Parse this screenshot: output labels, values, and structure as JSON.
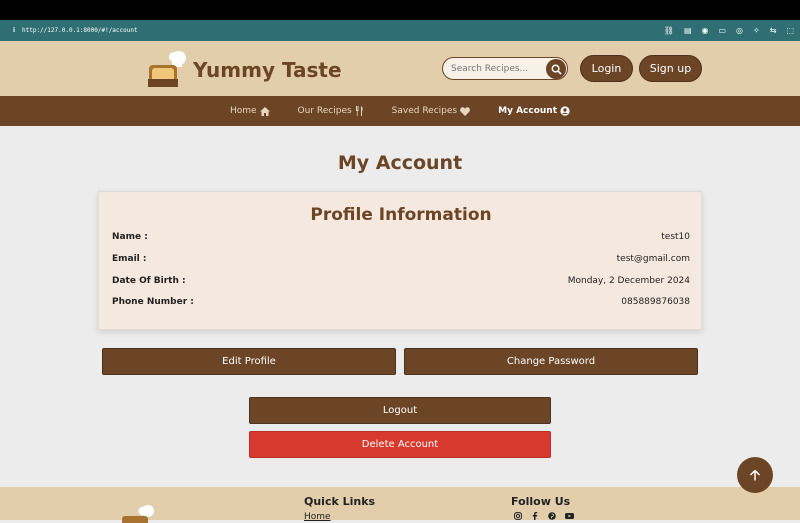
{
  "browser": {
    "info_glyph": "i",
    "url": "http://127.0.0.1:8000/#!/account",
    "tools": [
      "⛓",
      "▤",
      "◉",
      "▭",
      "◎",
      "✧",
      "⇆",
      "⬚"
    ]
  },
  "header": {
    "brand": "Yummy Taste",
    "search_placeholder": "Search Recipes...",
    "login_label": "Login",
    "signup_label": "Sign up"
  },
  "nav": {
    "items": [
      {
        "label": "Home",
        "icon": "home-icon"
      },
      {
        "label": "Our Recipes",
        "icon": "utensils-icon"
      },
      {
        "label": "Saved Recipes",
        "icon": "heart-icon"
      },
      {
        "label": "My Account",
        "icon": "user-circle-icon"
      }
    ]
  },
  "page": {
    "title": "My Account"
  },
  "profile": {
    "heading": "Profile Information",
    "fields": [
      {
        "label": "Name :",
        "value": "test10"
      },
      {
        "label": "Email :",
        "value": "test@gmail.com"
      },
      {
        "label": "Date Of Birth :",
        "value": "Monday, 2 December 2024"
      },
      {
        "label": "Phone Number :",
        "value": "085889876038"
      }
    ]
  },
  "actions": {
    "edit_profile": "Edit Profile",
    "change_password": "Change Password",
    "logout": "Logout",
    "delete_account": "Delete Account"
  },
  "footer": {
    "quick_links_heading": "Quick Links",
    "first_link": "Home",
    "follow_heading": "Follow Us",
    "social_icons": [
      "instagram-icon",
      "facebook-icon",
      "pinterest-icon",
      "youtube-icon"
    ]
  },
  "colors": {
    "brand_brown": "#6b4526",
    "header_beige": "#e3ceab",
    "danger_red": "#d83a2e"
  }
}
